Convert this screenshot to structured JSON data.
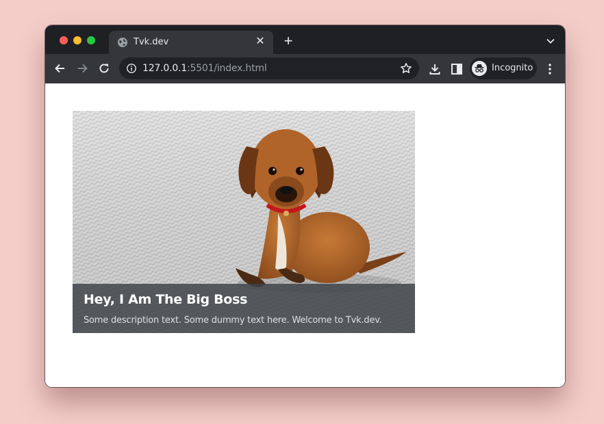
{
  "browser": {
    "tab": {
      "title": "Tvk.dev"
    },
    "address": {
      "host": "127.0.0.1",
      "path": ":5501/index.html"
    },
    "profile": {
      "label": "Incognito"
    }
  },
  "card": {
    "title": "Hey, I Am The Big Boss",
    "description": "Some description text. Some dummy text here. Welcome to Tvk.dev."
  },
  "icons": {
    "tab_favicon": "globe-icon",
    "tab_close": "close-icon",
    "new_tab": "plus-icon",
    "tab_search": "chevron-down-icon",
    "back": "arrow-left-icon",
    "forward": "arrow-right-icon",
    "reload": "reload-icon",
    "site_info": "info-icon",
    "bookmark": "star-icon",
    "downloads": "download-icon",
    "side_panel": "side-panel-icon",
    "menu": "kebab-menu-icon"
  },
  "colors": {
    "page_background": "#f4cdc9",
    "tabbar": "#1f2023",
    "toolbar": "#35363a",
    "omnibox": "#202124",
    "caption_overlay": "#3e4248"
  }
}
